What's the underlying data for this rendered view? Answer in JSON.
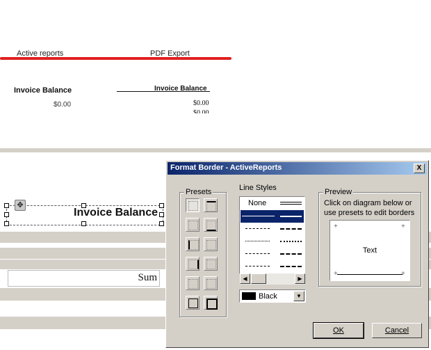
{
  "comparison": {
    "left_header": "Active reports",
    "right_header": "PDF Export",
    "left_field_label": "Invoice Balance",
    "left_field_value": "$0.00",
    "right_field_label": "Invoice Balance",
    "right_field_value": "$0.00",
    "right_field_value_2": "$0.00",
    "accent_color": "#e02020"
  },
  "designer": {
    "textbox_text": "Invoice Balance",
    "sum_text": "Sum"
  },
  "dialog": {
    "title": "Format Border - ActiveReports",
    "close_label": "X",
    "presets_title": "Presets",
    "line_styles_title": "Line Styles",
    "line_style_none": "None",
    "color_value": "Black",
    "preview_title": "Preview",
    "preview_instructions": "Click on diagram below or use presets to edit borders",
    "preview_text": "Text",
    "ok_label": "OK",
    "cancel_label": "Cancel"
  }
}
